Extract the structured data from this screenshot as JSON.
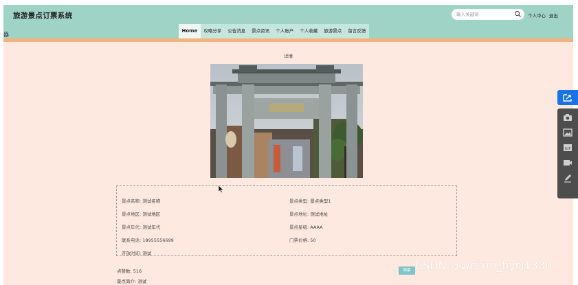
{
  "app": {
    "title": "旅游景点订票系统",
    "stray_char": "器"
  },
  "search": {
    "placeholder": "输入关键词"
  },
  "top_links": {
    "profile": "个人中心",
    "logout": "退出"
  },
  "nav": {
    "items": [
      {
        "label": "Home",
        "active": true
      },
      {
        "label": "攻略分享"
      },
      {
        "label": "公告消息"
      },
      {
        "label": "景点资讯"
      },
      {
        "label": "个人账户"
      },
      {
        "label": "个人收藏"
      },
      {
        "label": "旅游景点"
      },
      {
        "label": "留言反馈"
      }
    ]
  },
  "page": {
    "heading": "详情"
  },
  "details": {
    "name_label": "景点名称:",
    "name_value": "测试名称",
    "type_label": "景点类型:",
    "type_value": "景点类型1",
    "area_label": "景点地区:",
    "area_value": "测试地区",
    "address_label": "景点地址:",
    "address_value": "测试地址",
    "era_label": "景点年代:",
    "era_value": "测试年代",
    "level_label": "景点星级:",
    "level_value": "AAAA",
    "phone_label": "联系电话:",
    "phone_value": "18955556699",
    "price_label": "门票价格:",
    "price_value": "50",
    "hours_label": "开放时间:",
    "hours_value": "测试"
  },
  "extra": {
    "likes_label": "点赞数:",
    "likes_value": "516",
    "intro_label": "景点简介:",
    "intro_value": "测试"
  },
  "mini_button": "购票",
  "watermark": "CSDN @weixin_bysj1330",
  "colors": {
    "header_bg": "#9ed3c6",
    "page_bg": "#fde9df",
    "stripe": "#f4b27c",
    "side_primary": "#1a73e8",
    "side_rail": "#4d4d4d"
  }
}
